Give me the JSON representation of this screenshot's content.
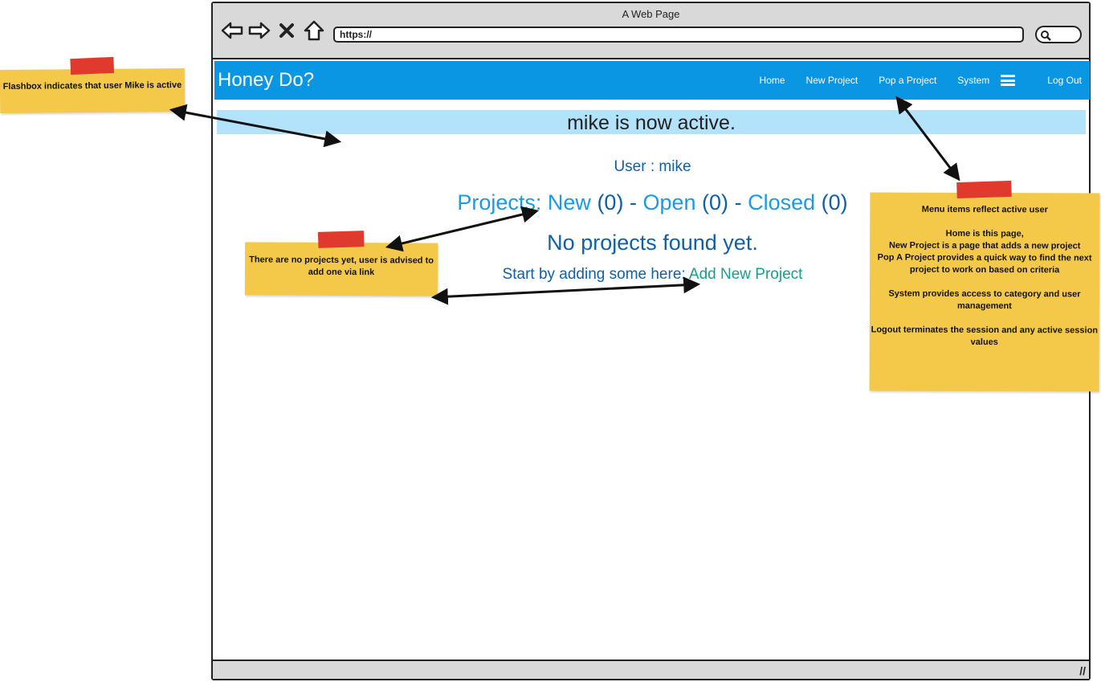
{
  "window": {
    "title": "A Web Page",
    "url": "https://"
  },
  "nav": {
    "brand": "Honey Do?",
    "items": [
      "Home",
      "New Project",
      "Pop a Project",
      "System"
    ],
    "logout": "Log Out"
  },
  "flash": "mike is now active.",
  "user": {
    "label": "User : mike"
  },
  "projects": {
    "label": "Projects:",
    "new_label": "New",
    "new_count": "(0)",
    "sep1": "-",
    "open_label": "Open",
    "open_count": "(0)",
    "sep2": "-",
    "closed_label": "Closed",
    "closed_count": "(0)"
  },
  "no_projects": "No projects found yet.",
  "start": {
    "text": "Start by adding some here:",
    "link": "Add New Project"
  },
  "notes": {
    "flashbox": "Flashbox indicates that user Mike is active",
    "no_projects": "There are no projects yet, user is advised to add one via link",
    "menu": [
      "Menu items reflect active user",
      "",
      "Home is this page,",
      "New Project is a page that adds a new project",
      "Pop A Project provides a quick way to find the next project to work on based on criteria",
      "",
      "System provides access to category and user management",
      "",
      "Logout terminates the session and any active session values"
    ]
  },
  "colors": {
    "navbar": "#0a96e3",
    "flash": "#b3e2fb",
    "note": "#f4c94a",
    "tape": "#e03a2f",
    "link": "#1a9ae6",
    "add_link": "#14a08a"
  }
}
